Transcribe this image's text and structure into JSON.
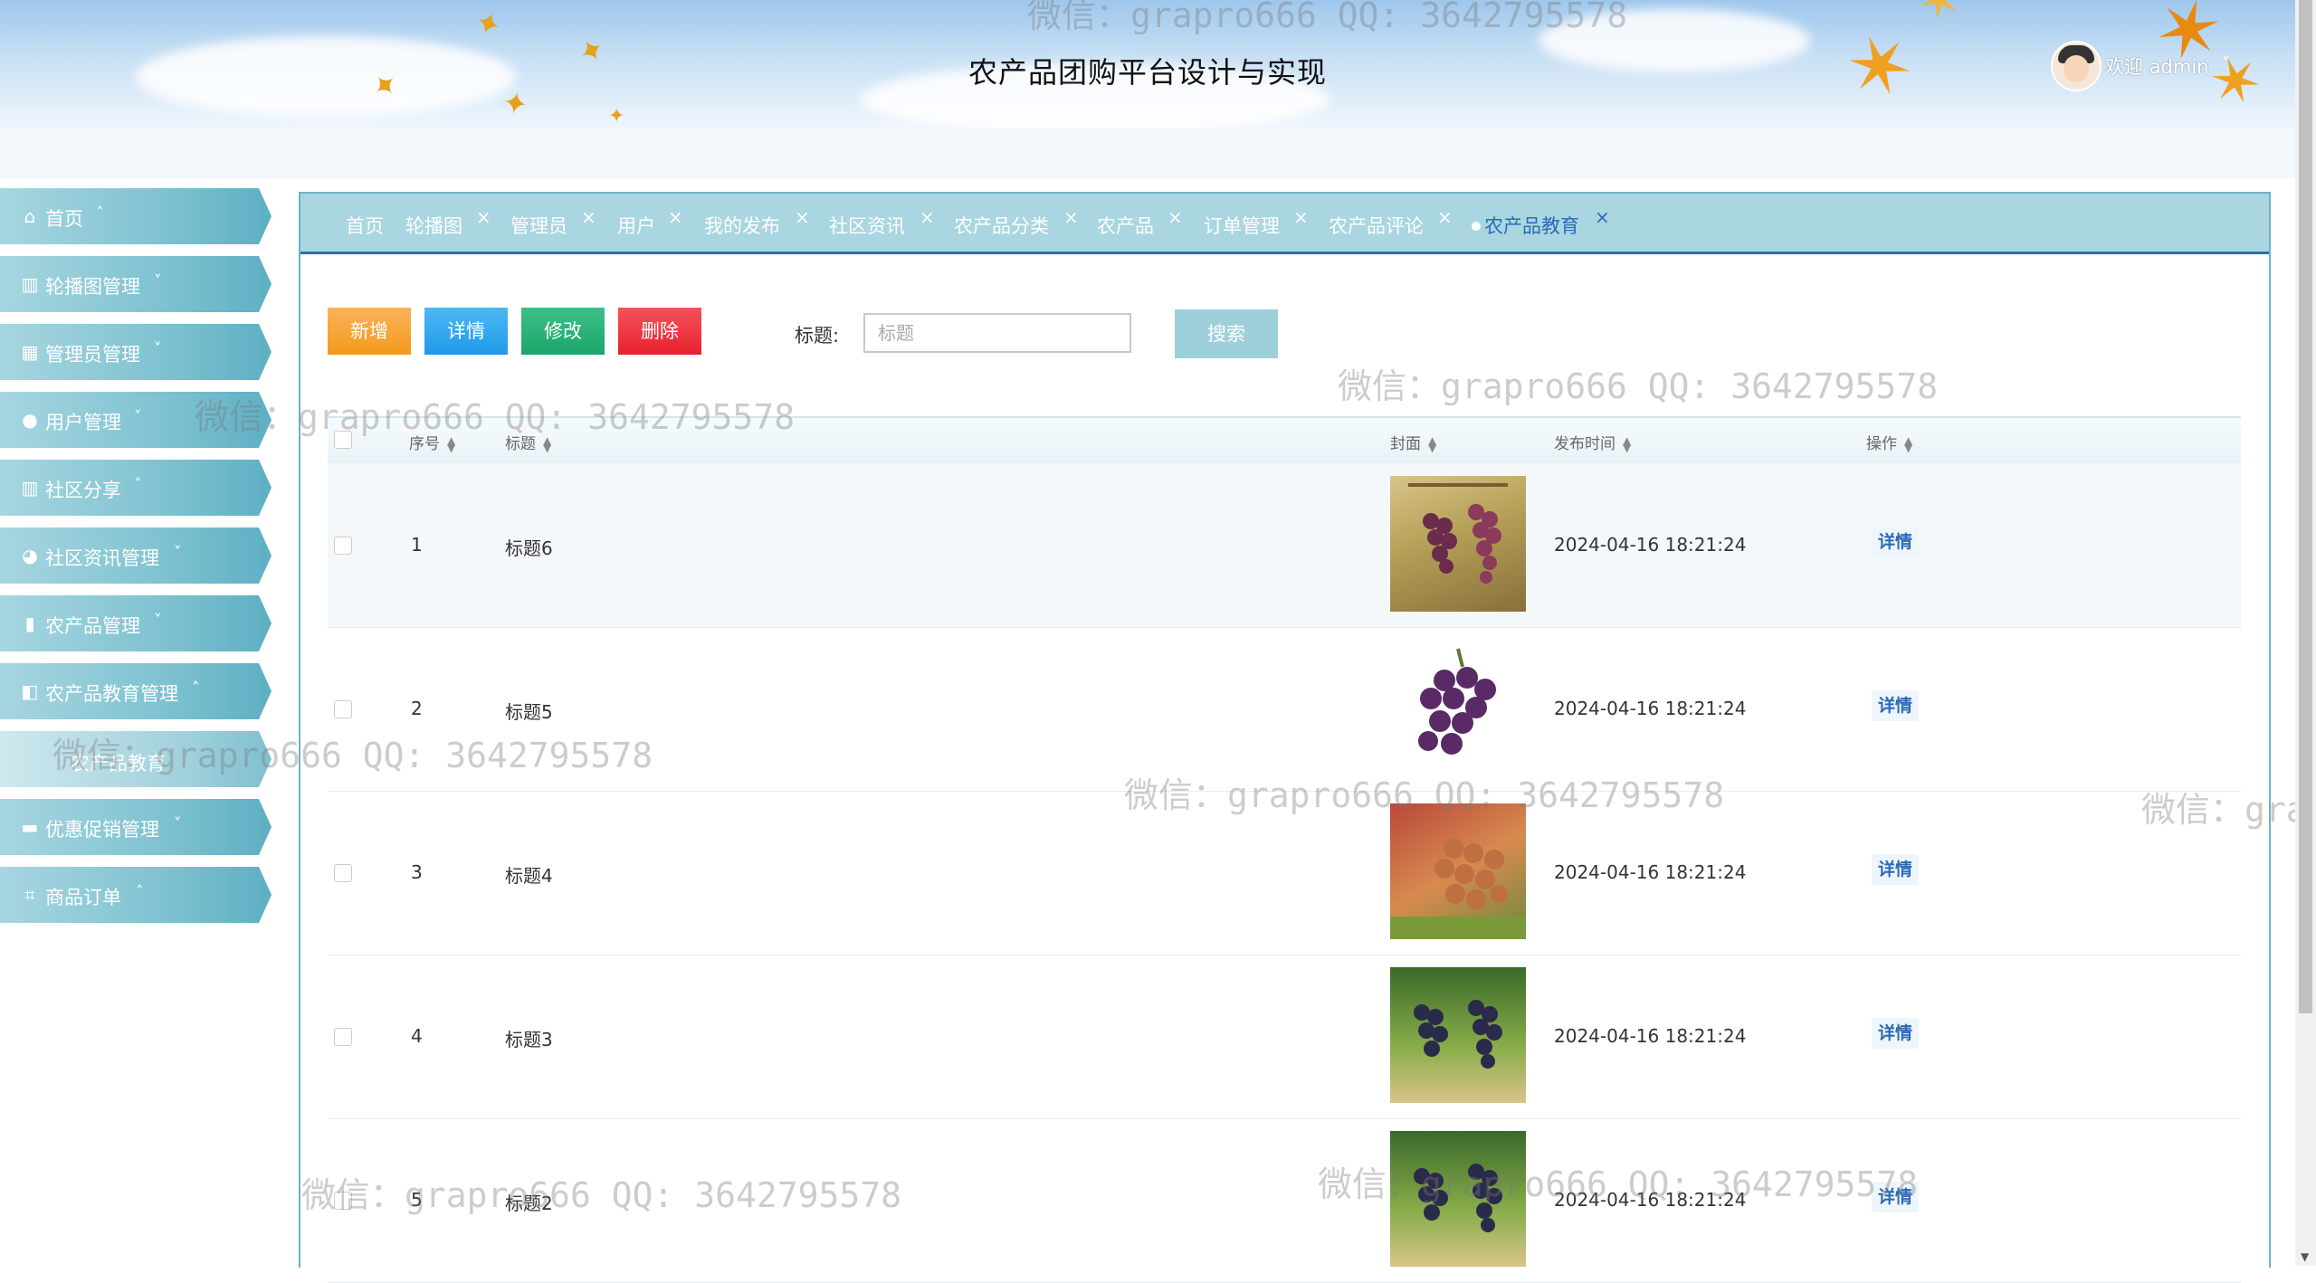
{
  "header": {
    "title": "农产品团购平台设计与实现",
    "welcome": "欢迎 admin"
  },
  "sidebar": {
    "items": [
      {
        "label": "首页",
        "icon": "home-icon",
        "arrow": "˄"
      },
      {
        "label": "轮播图管理",
        "icon": "chart-icon",
        "arrow": "˅"
      },
      {
        "label": "管理员管理",
        "icon": "dashboard-icon",
        "arrow": "˅"
      },
      {
        "label": "用户管理",
        "icon": "user-icon",
        "arrow": "˅"
      },
      {
        "label": "社区分享",
        "icon": "bar-chart-icon",
        "arrow": "˅"
      },
      {
        "label": "社区资讯管理",
        "icon": "compass-icon",
        "arrow": "˅"
      },
      {
        "label": "农产品管理",
        "icon": "bookmark-icon",
        "arrow": "˅"
      },
      {
        "label": "农产品教育管理",
        "icon": "panel-icon",
        "arrow": "˄"
      },
      {
        "label": "优惠促销管理",
        "icon": "card-icon",
        "arrow": "˅"
      },
      {
        "label": "商品订单",
        "icon": "crop-icon",
        "arrow": "˄"
      }
    ],
    "subitem": "农产品教育"
  },
  "tabs": [
    {
      "label": "首页"
    },
    {
      "label": "轮播图"
    },
    {
      "label": "管理员"
    },
    {
      "label": "用户"
    },
    {
      "label": "我的发布"
    },
    {
      "label": "社区资讯"
    },
    {
      "label": "农产品分类"
    },
    {
      "label": "农产品"
    },
    {
      "label": "订单管理"
    },
    {
      "label": "农产品评论"
    },
    {
      "label": "农产品教育"
    }
  ],
  "toolbar": {
    "add": "新增",
    "detail": "详情",
    "edit": "修改",
    "delete": "删除",
    "search_label": "标题:",
    "search_placeholder": "标题",
    "search_button": "搜索"
  },
  "table": {
    "columns": [
      "序号",
      "标题",
      "封面",
      "发布时间",
      "操作"
    ],
    "rows": [
      {
        "index": "1",
        "title": "标题6",
        "time": "2024-04-16 18:21:24",
        "action": "详情"
      },
      {
        "index": "2",
        "title": "标题5",
        "time": "2024-04-16 18:21:24",
        "action": "详情"
      },
      {
        "index": "3",
        "title": "标题4",
        "time": "2024-04-16 18:21:24",
        "action": "详情"
      },
      {
        "index": "4",
        "title": "标题3",
        "time": "2024-04-16 18:21:24",
        "action": "详情"
      },
      {
        "index": "5",
        "title": "标题2",
        "time": "2024-04-16 18:21:24",
        "action": "详情"
      }
    ]
  },
  "watermark": "微信：grapro666 QQ: 3642795578",
  "colors": {
    "sidebar": "#7fc2d1",
    "tabbar": "#a9d6e0",
    "add": "#f39a1c",
    "detail": "#1e9ae8",
    "edit": "#1aa66a",
    "delete": "#e6222e",
    "link": "#2a6ab6"
  }
}
